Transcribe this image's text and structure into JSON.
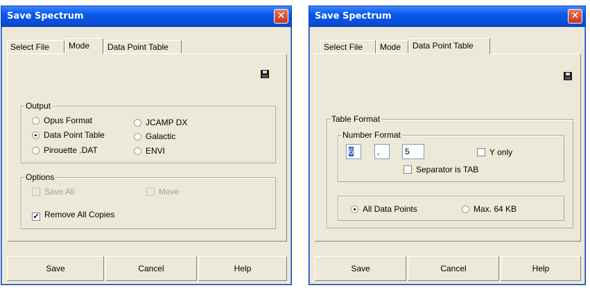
{
  "left_dialog": {
    "title": "Save Spectrum",
    "close_glyph": "✕",
    "tabs": [
      "Select File",
      "Mode",
      "Data Point Table"
    ],
    "active_tab": "Mode",
    "save_icon": "floppy-disk-icon",
    "output": {
      "label": "Output",
      "options": [
        {
          "label": "Opus Format",
          "selected": false
        },
        {
          "label": "Data Point Table",
          "selected": true
        },
        {
          "label": "Pirouette .DAT",
          "selected": false
        },
        {
          "label": "JCAMP DX",
          "selected": false
        },
        {
          "label": "Galactic",
          "selected": false
        },
        {
          "label": "ENVI",
          "selected": false
        }
      ]
    },
    "options": {
      "label": "Options",
      "save_all": {
        "label": "Save All",
        "checked": false,
        "enabled": false
      },
      "move": {
        "label": "Move",
        "checked": false,
        "enabled": false
      },
      "remove_all_copies": {
        "label": "Remove All Copies",
        "checked": true,
        "enabled": true
      }
    },
    "buttons": {
      "save": "Save",
      "cancel": "Cancel",
      "help": "Help"
    }
  },
  "right_dialog": {
    "title": "Save Spectrum",
    "close_glyph": "✕",
    "tabs": [
      "Select File",
      "Mode",
      "Data Point Table"
    ],
    "active_tab": "Data Point Table",
    "save_icon": "floppy-disk-icon",
    "table_format": {
      "label": "Table Format",
      "number_format": {
        "label": "Number Format",
        "digits": "6",
        "separator": ",",
        "decimals": "5",
        "y_only": {
          "label": "Y only",
          "checked": false
        },
        "separator_tab": {
          "label": "Separator is TAB",
          "checked": false
        }
      },
      "range": {
        "all_data_points": {
          "label": "All Data Points",
          "selected": true
        },
        "max_64kb": {
          "label": "Max. 64 KB",
          "selected": false
        }
      }
    },
    "buttons": {
      "save": "Save",
      "cancel": "Cancel",
      "help": "Help"
    }
  }
}
